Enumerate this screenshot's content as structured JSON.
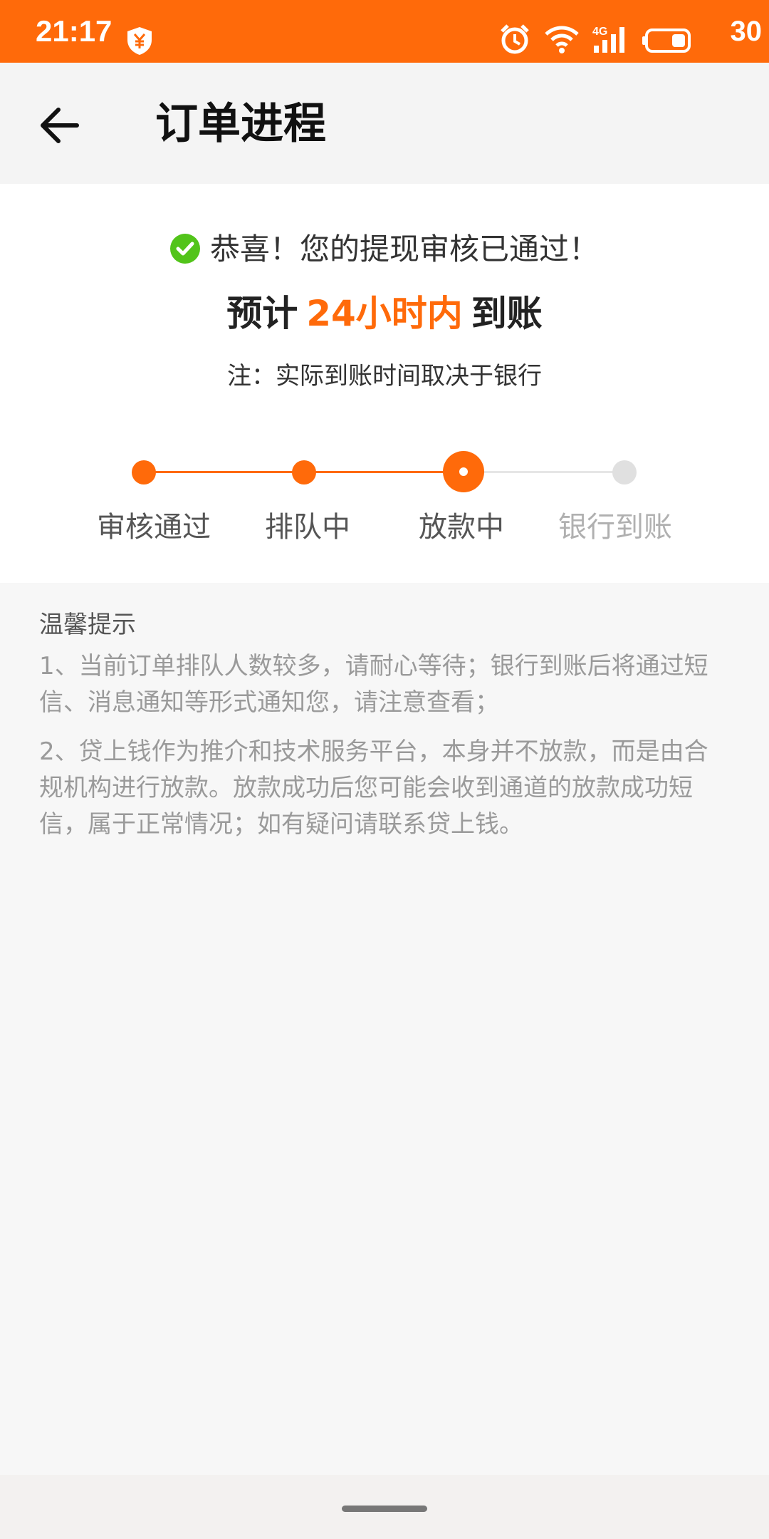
{
  "status_bar": {
    "time": "21:17",
    "network_type": "4G",
    "battery_level": "30",
    "icons": [
      "shield-yen-icon",
      "alarm-icon",
      "wifi-icon",
      "signal-icon",
      "battery-icon"
    ]
  },
  "header": {
    "back_icon": "arrow-left-icon",
    "title": "订单进程"
  },
  "result": {
    "success_message": "恭喜！您的提现审核已通过！",
    "eta_prefix": "预计",
    "eta_highlight": "24小时内",
    "eta_suffix": "到账",
    "note": "注：实际到账时间取决于银行"
  },
  "progress": {
    "current_step": 3,
    "steps": [
      {
        "label": "审核通过"
      },
      {
        "label": "排队中"
      },
      {
        "label": "放款中"
      },
      {
        "label": "银行到账"
      }
    ]
  },
  "tips": {
    "title": "温馨提示",
    "items": [
      "1、当前订单排队人数较多，请耐心等待；银行到账后将通过短信、消息通知等形式通知您，请注意查看；",
      "2、贷上钱作为推介和技术服务平台，本身并不放款，而是由合规机构进行放款。放款成功后您可能会收到通道的放款成功短信，属于正常情况；如有疑问请联系贷上钱。"
    ]
  },
  "colors": {
    "accent": "#ff6a0a",
    "inactive": "#dddddd",
    "success": "#52c41a"
  }
}
